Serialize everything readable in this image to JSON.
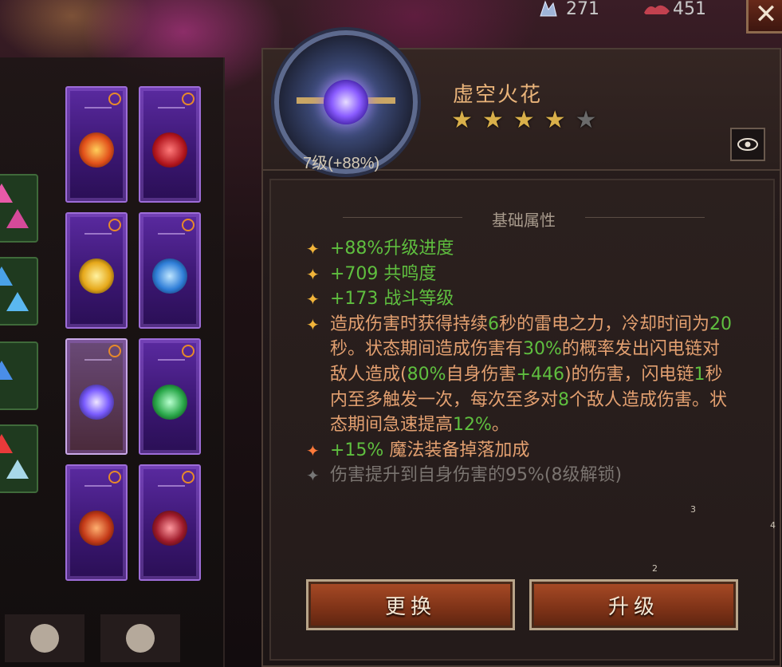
{
  "currencies": [
    {
      "icon": "crystal-icon",
      "value": "271"
    },
    {
      "icon": "scrap-icon",
      "value": "451"
    }
  ],
  "close_label": "✕",
  "item": {
    "name": "虚空火花",
    "stars_filled": 4,
    "stars_total": 5,
    "level_text": "7级(+88%)"
  },
  "attributes": {
    "section_title": "基础属性",
    "lines": [
      {
        "parts": [
          {
            "t": "+88%升级进度",
            "c": "green"
          }
        ]
      },
      {
        "parts": [
          {
            "t": "+709 共鸣度",
            "c": "green"
          }
        ]
      },
      {
        "parts": [
          {
            "t": "+173 战斗等级",
            "c": "green"
          }
        ]
      },
      {
        "parts": [
          {
            "t": "造成伤害时获得持续",
            "c": "orange"
          },
          {
            "t": "6",
            "c": "green"
          },
          {
            "t": "秒的雷电之力，冷却时间为",
            "c": "orange"
          },
          {
            "t": "20",
            "c": "green"
          },
          {
            "t": "秒。状态期间造成伤害有",
            "c": "orange"
          },
          {
            "t": "30%",
            "c": "green"
          },
          {
            "t": "的概率发出闪电链对敌人造成(",
            "c": "orange"
          },
          {
            "t": "80%",
            "c": "green"
          },
          {
            "t": "自身伤害",
            "c": "orange"
          },
          {
            "t": "+446",
            "c": "green"
          },
          {
            "t": ")的伤害，闪电链",
            "c": "orange"
          },
          {
            "t": "1",
            "c": "green"
          },
          {
            "t": "秒内至多触发一次，每次至多对",
            "c": "orange"
          },
          {
            "t": "8",
            "c": "green"
          },
          {
            "t": "个敌人造成伤害。状态期间急速提高",
            "c": "orange"
          },
          {
            "t": "12%",
            "c": "green"
          },
          {
            "t": "。",
            "c": "orange"
          }
        ]
      },
      {
        "bullet": "red",
        "parts": [
          {
            "t": "+15%",
            "c": "green"
          },
          {
            "t": " 魔法装备掉落加成",
            "c": "orange"
          }
        ]
      },
      {
        "bullet": "grey",
        "locked": true,
        "parts": [
          {
            "t": "伤害提升到自身伤害的95%(8级解锁)",
            "c": "grey"
          }
        ]
      }
    ]
  },
  "small_numbers": [
    "3",
    "4",
    "2"
  ],
  "buttons": {
    "replace": "更换",
    "upgrade": "升级"
  }
}
